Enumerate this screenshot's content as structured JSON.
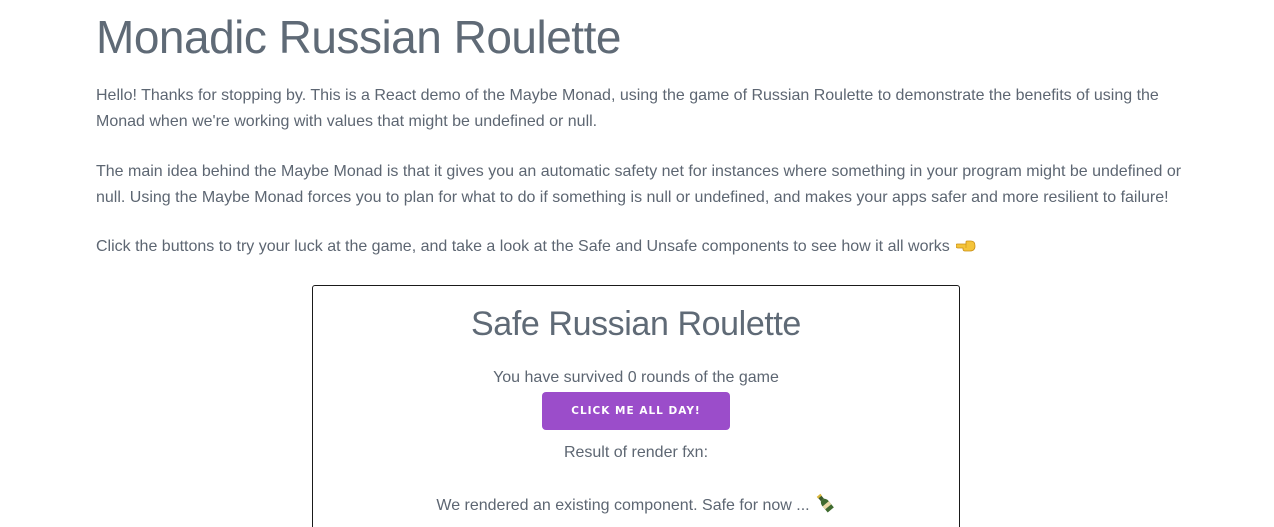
{
  "header": {
    "title": "Monadic Russian Roulette"
  },
  "intro": {
    "paragraph1": "Hello! Thanks for stopping by. This is a React demo of the Maybe Monad, using the game of Russian Roulette to demonstrate the benefits of using the Monad when we're working with values that might be undefined or null.",
    "paragraph2": "The main idea behind the Maybe Monad is that it gives you an automatic safety net for instances where something in your program might be undefined or null. Using the Maybe Monad forces you to plan for what to do if something is null or undefined, and makes your apps safer and more resilient to failure!",
    "paragraph3": "Click the buttons to try your luck at the game, and take a look at the Safe and Unsafe components to see how it all works",
    "paragraph3_icon": "backhand-pointing-left-icon"
  },
  "safe_game": {
    "title": "Safe Russian Roulette",
    "survived_text": "You have survived 0 rounds of the game",
    "button_label": "Click me all day!",
    "result_label": "Result of render fxn:",
    "result_text": "We rendered an existing component. Safe for now ...",
    "result_icon": "champagne-bottle-icon"
  },
  "colors": {
    "accent": "#9b4dca",
    "text": "#5d6672",
    "heading": "#5f6a76",
    "card_border": "#1a1a1a"
  }
}
